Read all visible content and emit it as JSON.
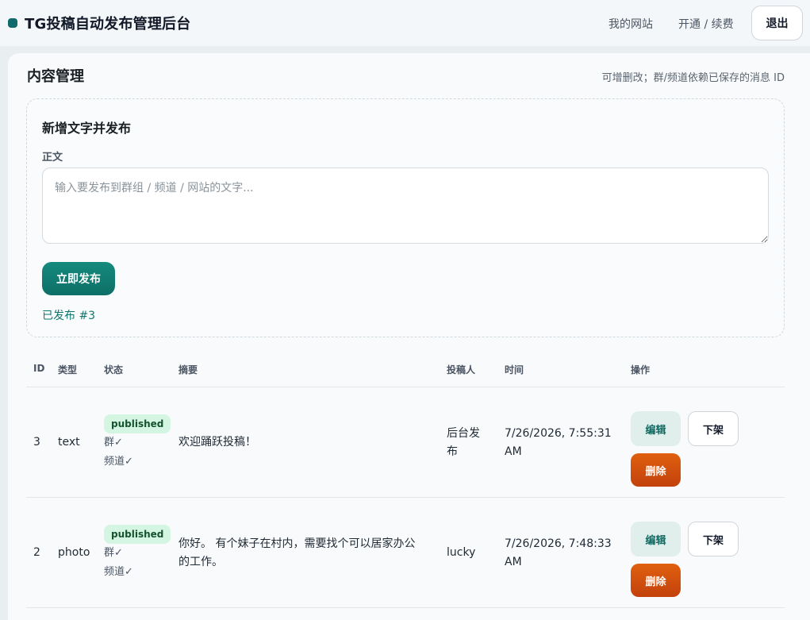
{
  "header": {
    "brand": "TG投稿自动发布管理后台",
    "nav": [
      "我的网站",
      "开通 / 续费"
    ],
    "logout_label": "退出"
  },
  "content": {
    "title": "内容管理",
    "hint": "可增删改；群/频道依赖已保存的消息 ID"
  },
  "composer": {
    "title": "新增文字并发布",
    "body_label": "正文",
    "placeholder": "输入要发布到群组 / 频道 / 网站的文字...",
    "publish_label": "立即发布",
    "status_message": "已发布 #3"
  },
  "table": {
    "headers": [
      "ID",
      "类型",
      "状态",
      "摘要",
      "投稿人",
      "时间",
      "操作"
    ],
    "rows": [
      {
        "id": "3",
        "type": "text",
        "status": "published",
        "group_sync": "群✓",
        "channel_sync": "频道✓",
        "summary": [
          "欢迎踊跃投稿！"
        ],
        "author": [
          "后台发",
          "布"
        ],
        "time": [
          "7/26/2026, 7:55:31",
          "AM"
        ],
        "edit_label": "编辑",
        "offline_label": "下架",
        "delete_label": "删除"
      },
      {
        "id": "2",
        "type": "photo",
        "status": "published",
        "group_sync": "群✓",
        "channel_sync": "频道✓",
        "summary": [
          "你好。 有个妹子在村内，需要找个可以居家办公",
          "的工作。"
        ],
        "author": [
          "lucky"
        ],
        "time": [
          "7/26/2026, 7:48:33",
          "AM"
        ],
        "edit_label": "编辑",
        "offline_label": "下架",
        "delete_label": "删除"
      }
    ]
  },
  "colors": {
    "accent": "#0f6b6b",
    "badge_bg": "#d5f5e3",
    "delete": "#c2410c"
  },
  "icons": {
    "brand": "brand-dot-icon"
  }
}
